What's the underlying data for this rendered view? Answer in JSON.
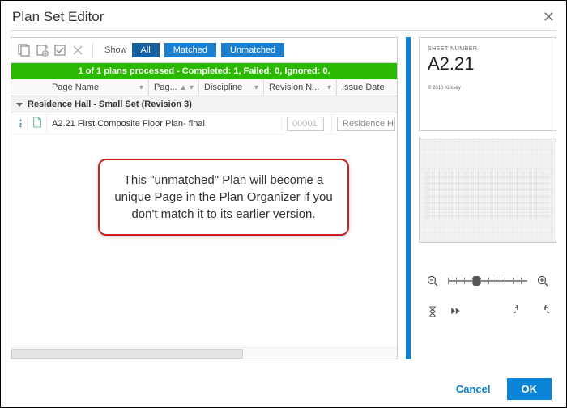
{
  "dialog": {
    "title": "Plan Set Editor"
  },
  "toolbar": {
    "show_label": "Show",
    "filters": {
      "all": "All",
      "matched": "Matched",
      "unmatched": "Unmatched"
    }
  },
  "status_bar": "1 of 1 plans processed - Completed: 1, Failed: 0, Ignored: 0.",
  "columns": {
    "page_name": "Page Name",
    "page_no": "Pag...",
    "discipline": "Discipline",
    "revision": "Revision N...",
    "issue_date": "Issue Date"
  },
  "group": {
    "label": "Residence Hall - Small Set (Revision 3)"
  },
  "rows": [
    {
      "handle": "⋮⋮",
      "page_name": "A2.21 First Composite Floor Plan- final",
      "page_no_placeholder": "00001",
      "discipline_placeholder": "Residence H"
    }
  ],
  "annotation": "This \"unmatched\" Plan will become a unique Page in the Plan Organizer if you don't match it to its earlier version.",
  "preview": {
    "sheet_number_label": "SHEET NUMBER",
    "sheet_number": "A2.21",
    "copyright": "© 2010 Kirksey"
  },
  "footer": {
    "cancel": "Cancel",
    "ok": "OK"
  }
}
